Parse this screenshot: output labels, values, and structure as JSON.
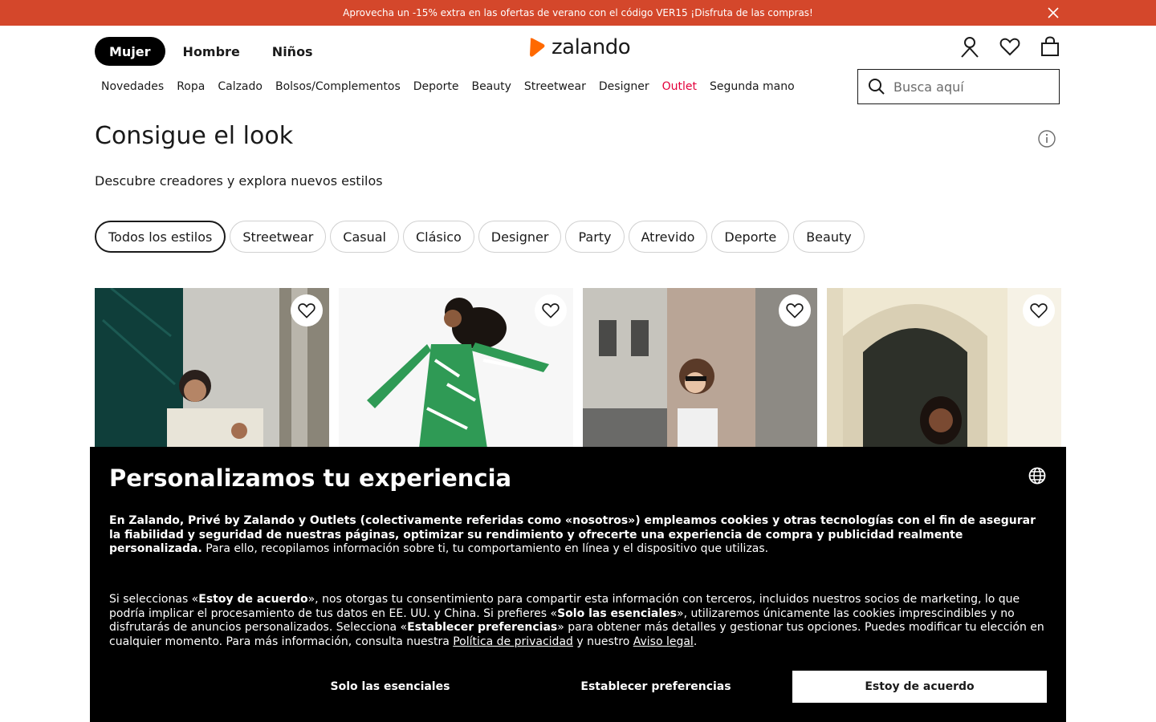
{
  "promo": {
    "text": "Aprovecha un -15% extra en las ofertas de verano con el código VER15 ¡Disfruta de las compras!",
    "color": "#d4472b"
  },
  "gender_tabs": [
    {
      "label": "Mujer",
      "active": true
    },
    {
      "label": "Hombre",
      "active": false
    },
    {
      "label": "Niños",
      "active": false
    }
  ],
  "logo": {
    "text": "zalando",
    "brand_color": "#ff6900"
  },
  "header_icons": [
    "user-icon",
    "heart-icon",
    "shopping-bag-icon"
  ],
  "categories": [
    "Novedades",
    "Ropa",
    "Calzado",
    "Bolsos/Complementos",
    "Deporte",
    "Beauty",
    "Streetwear",
    "Designer",
    "Outlet",
    "Segunda mano"
  ],
  "outlet_color": "#e3003b",
  "search": {
    "placeholder": "Busca aquí"
  },
  "page": {
    "title": "Consigue el look",
    "subtitle": "Descubre creadores y explora nuevos estilos"
  },
  "style_chips": [
    {
      "label": "Todos los estilos",
      "active": true
    },
    {
      "label": "Streetwear"
    },
    {
      "label": "Casual"
    },
    {
      "label": "Clásico"
    },
    {
      "label": "Designer"
    },
    {
      "label": "Party"
    },
    {
      "label": "Atrevido"
    },
    {
      "label": "Deporte"
    },
    {
      "label": "Beauty"
    }
  ],
  "cards": [
    {
      "image": "woman-in-white-top-green-wall"
    },
    {
      "image": "woman-in-green-print-dress"
    },
    {
      "image": "woman-with-sunglasses-street"
    },
    {
      "image": "woman-in-front-of-door"
    }
  ],
  "cookie": {
    "title": "Personalizamos tu experiencia",
    "p1_bold": "En Zalando, Privé by Zalando y Outlets (colectivamente referidas como «nosotros») empleamos cookies y otras tecnologías con el fin de asegurar la fiabilidad y seguridad de nuestras páginas, optimizar su rendimiento y ofrecerte una experiencia de compra y publicidad realmente personalizada.",
    "p1_rest": " Para ello, recopilamos información sobre ti, tu comportamiento en línea y el dispositivo que utilizas.",
    "p2_a": "Si seleccionas «",
    "p2_b": "Estoy de acuerdo",
    "p2_c": "», nos otorgas tu consentimiento para compartir esta información con terceros, incluidos nuestros socios de marketing, lo que podría implicar el procesamiento de tus datos en EE. UU. y China. Si prefieres «",
    "p2_d": "Solo las esenciales",
    "p2_e": "», utilizaremos únicamente las cookies imprescindibles y no disfrutarás de anuncios personalizados. Selecciona «",
    "p2_f": "Establecer preferencias",
    "p2_g": "» para obtener más detalles y gestionar tus opciones. Puedes modificar tu elección en cualquier momento. Para más información, consulta nuestra ",
    "privacy_link": "Política de privacidad",
    "p2_h": " y nuestro ",
    "legal_link": "Aviso legal",
    "p2_i": ".",
    "btn_essential": "Solo las esenciales",
    "btn_prefs": "Establecer preferencias",
    "btn_accept": "Estoy de acuerdo"
  }
}
